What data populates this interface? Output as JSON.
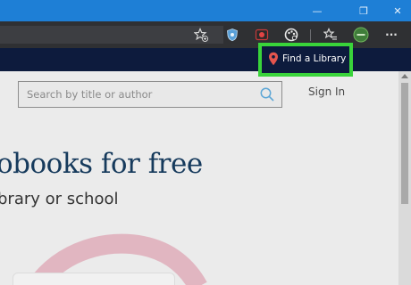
{
  "window": {
    "controls": {
      "minimize": "—",
      "maximize": "❐",
      "close": "✕"
    }
  },
  "browser_toolbar": {
    "icons": [
      "favorite-star-add-icon",
      "shield-extension-icon",
      "record-extension-icon",
      "palette-extension-icon",
      "favorites-list-icon",
      "profile-avatar",
      "more-menu-icon"
    ],
    "more_label": "···"
  },
  "site": {
    "find_library_label": "Find a Library",
    "search": {
      "placeholder": "Search by title or author"
    },
    "sign_in_label": "Sign In",
    "hero_title": "obooks for free",
    "hero_subtitle": "brary or school"
  },
  "colors": {
    "accent_highlight": "#39d43a",
    "navbar": "#0d1b3d",
    "title": "#163a5c",
    "pin": "#e4554e",
    "titlebar": "#1e7fd6"
  }
}
